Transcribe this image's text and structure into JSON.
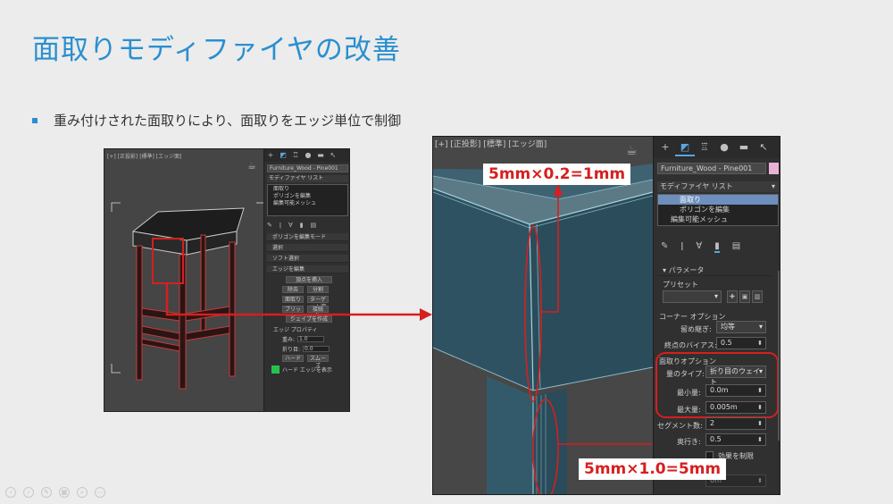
{
  "slide": {
    "title": "面取りモディファイヤの改善",
    "bullet": "重み付けされた面取りにより、面取りをエッジ単位で制御"
  },
  "left_screenshot": {
    "viewport_label": "[+] [正投影] [標準] [エッジ面]",
    "object_name": "Furniture_Wood - Pine001",
    "modifier_list": "モディファイヤ リスト",
    "stack": [
      "面取り",
      "ポリゴンを編集",
      "編集可能メッシュ"
    ],
    "rollouts": [
      "ポリゴンを編集モード",
      "選択",
      "ソフト選択",
      "エッジを編集"
    ],
    "buttons": {
      "insert_vertex": "頂点を挿入",
      "remove": "除去",
      "split": "分割",
      "chamfer": "面取り",
      "weld": "溶接",
      "target_weld": "ターゲット溶接",
      "bridge": "ブリッジ",
      "connect": "接続",
      "create_shape": "シェイプを作成"
    },
    "edge_props_label": "エッジ プロパティ",
    "weight_label": "重み:",
    "weight_value": "1.0",
    "crease_label": "折り目:",
    "crease_value": "0.0",
    "hard_label": "ハード",
    "smooth_label": "スムーズ",
    "show_hard_edges": "ハード エッジを表示"
  },
  "right_screenshot": {
    "viewport_label": "[+] [正投影] [標準] [エッジ面]",
    "object_name": "Furniture_Wood - Pine001",
    "modifier_list": "モディファイヤ リスト",
    "stack": [
      "面取り",
      "ポリゴンを編集",
      "編集可能メッシュ"
    ],
    "params_rollout": "パラメータ",
    "presets_label": "プリセット",
    "corner_options_label": "コーナー オプション",
    "miter_label": "留め継ぎ:",
    "miter_value": "均等",
    "endpoint_bias_label": "終点のバイアス:",
    "endpoint_bias_value": "0.5",
    "chamfer_options_label": "面取りオプション",
    "amount_type_label": "量のタイプ:",
    "amount_type_value": "折り目のウェイト",
    "min_amount_label": "最小量:",
    "min_amount_value": "0.0m",
    "max_amount_label": "最大量:",
    "max_amount_value": "0.005m",
    "segments_label": "セグメント数:",
    "segments_value": "2",
    "depth_label": "奥行き:",
    "depth_value": "0.5",
    "limit_effect_label": "効果を制限",
    "faded_value": "0m"
  },
  "callouts": {
    "top": "5mm×0.2=1mm",
    "bottom": "5mm×1.0=5mm"
  },
  "icons": {
    "create_tab": "plus-icon",
    "modify_tab": "bend-icon",
    "hierarchy_tab": "hierarchy-icon",
    "motion_tab": "motion-icon",
    "display_tab": "display-icon",
    "utilities_tab": "wrench-icon"
  },
  "colors": {
    "title_blue": "#2a8fd0",
    "highlight_red": "#d61f1f",
    "selection_blue": "#6d8fbd",
    "swatch_pink": "#e8b2d6",
    "hard_edge_green": "#27c24c"
  }
}
